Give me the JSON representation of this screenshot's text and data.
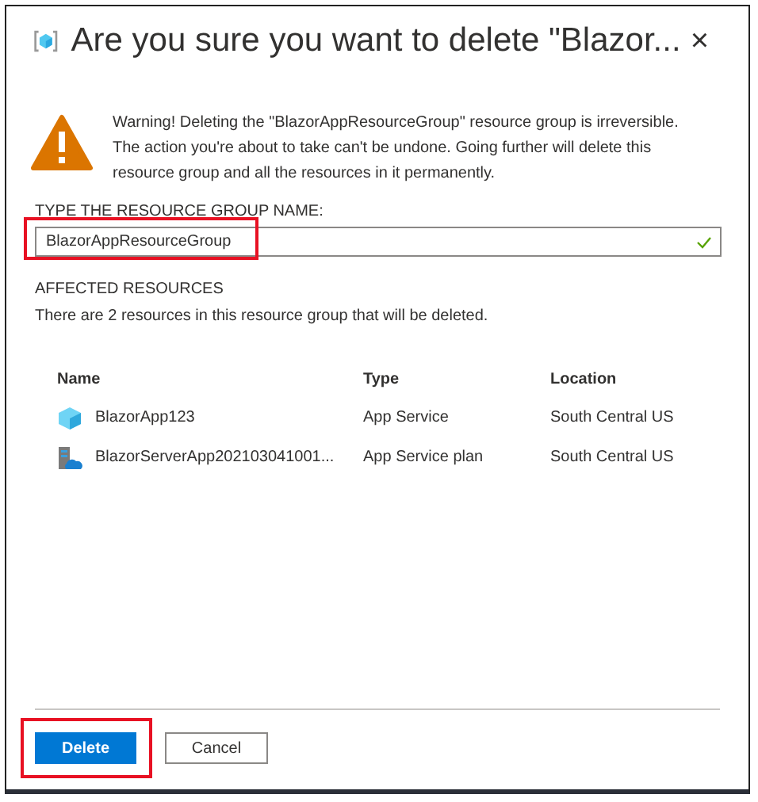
{
  "dialog": {
    "title": "Are you sure you want to delete \"Blazor...",
    "close": "×"
  },
  "warning": {
    "text": "Warning! Deleting the \"BlazorAppResourceGroup\" resource group is irreversible. The action you're about to take can't be undone. Going further will delete this resource group and all the resources in it permanently."
  },
  "name_field": {
    "label": "TYPE THE RESOURCE GROUP NAME:",
    "value": "BlazorAppResourceGroup",
    "valid": true,
    "highlighted": true
  },
  "affected": {
    "heading": "AFFECTED RESOURCES",
    "description": "There are 2 resources in this resource group that will be deleted."
  },
  "table": {
    "columns": [
      "Name",
      "Type",
      "Location"
    ],
    "rows": [
      {
        "kind": "app",
        "name": "BlazorApp123",
        "type": "App Service",
        "location": "South Central US"
      },
      {
        "kind": "plan",
        "name": "BlazorServerApp202103041001...",
        "type": "App Service plan",
        "location": "South Central US"
      }
    ]
  },
  "buttons": [
    {
      "label": "Delete",
      "primary": true,
      "highlighted": true
    },
    {
      "label": "Cancel",
      "primary": false,
      "highlighted": false
    }
  ]
}
